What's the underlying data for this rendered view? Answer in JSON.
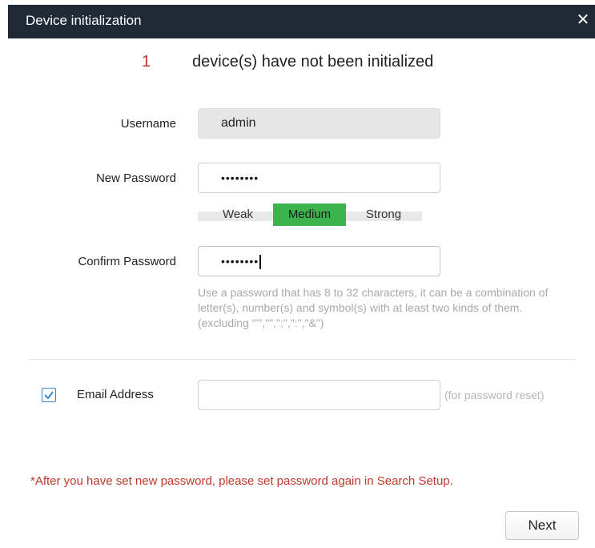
{
  "window": {
    "title": "Device initialization"
  },
  "status": {
    "count": "1",
    "message": "device(s) have not been initialized"
  },
  "form": {
    "username": {
      "label": "Username",
      "value": "admin"
    },
    "new_password": {
      "label": "New Password",
      "masked_value": "••••••••"
    },
    "strength": {
      "levels": [
        "Weak",
        "Medium",
        "Strong"
      ],
      "selected": "Medium",
      "selected_color": "#3cb44b"
    },
    "confirm_password": {
      "label": "Confirm Password",
      "masked_value": "••••••••"
    },
    "hint": "Use a password that has 8 to 32 characters, it can be a combination of letter(s), number(s) and symbol(s) with at least two kinds of them. (excluding \"'\",\"\",\";\",\":\",\"&\")",
    "email": {
      "checked": true,
      "label": "Email Address",
      "value": "",
      "hint": "(for password reset)"
    }
  },
  "warning": "*After you have set new password, please set password again in Search Setup.",
  "buttons": {
    "next": "Next"
  },
  "icons": {
    "close": "close-icon",
    "checkbox": "checkmark-icon"
  },
  "colors": {
    "titlebar": "#1f2a36",
    "warning": "#c0392b",
    "accent": "#3a86c8"
  }
}
